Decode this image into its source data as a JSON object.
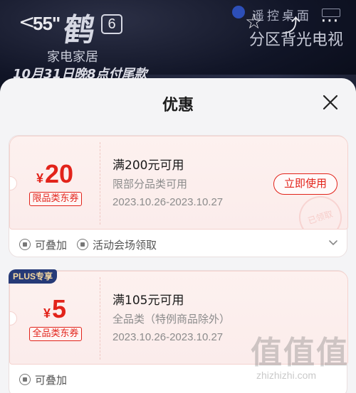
{
  "background": {
    "back_glyph": "<",
    "inch": "55\"",
    "logo_char": "鹤",
    "gen_badge": "6",
    "sub1": "家电家居",
    "sub2": "10月31日晚8点付尾款",
    "remote": "遥控桌面",
    "right_title": "分区背光电视",
    "icons": [
      "back-icon",
      "star-icon",
      "share-icon",
      "more-icon"
    ]
  },
  "sheet": {
    "title": "优惠"
  },
  "coupons": [
    {
      "currency": "¥",
      "amount": "20",
      "type_tag": "限品类东券",
      "title": "满200元可用",
      "scope": "限部分品类可用",
      "date": "2023.10.26-2023.10.27",
      "action": "立即使用",
      "stamp": "已领取",
      "meta1": "可叠加",
      "meta2": "活动会场领取"
    },
    {
      "badge": "PLUS专享",
      "currency": "¥",
      "amount": "5",
      "type_tag": "全品类东券",
      "title": "满105元可用",
      "scope": "全品类（特例商品除外）",
      "date": "2023.10.26-2023.10.27",
      "meta1": "可叠加"
    }
  ],
  "watermark": {
    "text": "值值值",
    "url": "zhizhizhi.com"
  },
  "colors": {
    "accent": "#e2231a",
    "plus_badge_bg": "#263a77",
    "plus_badge_text": "#f5d9a1"
  }
}
